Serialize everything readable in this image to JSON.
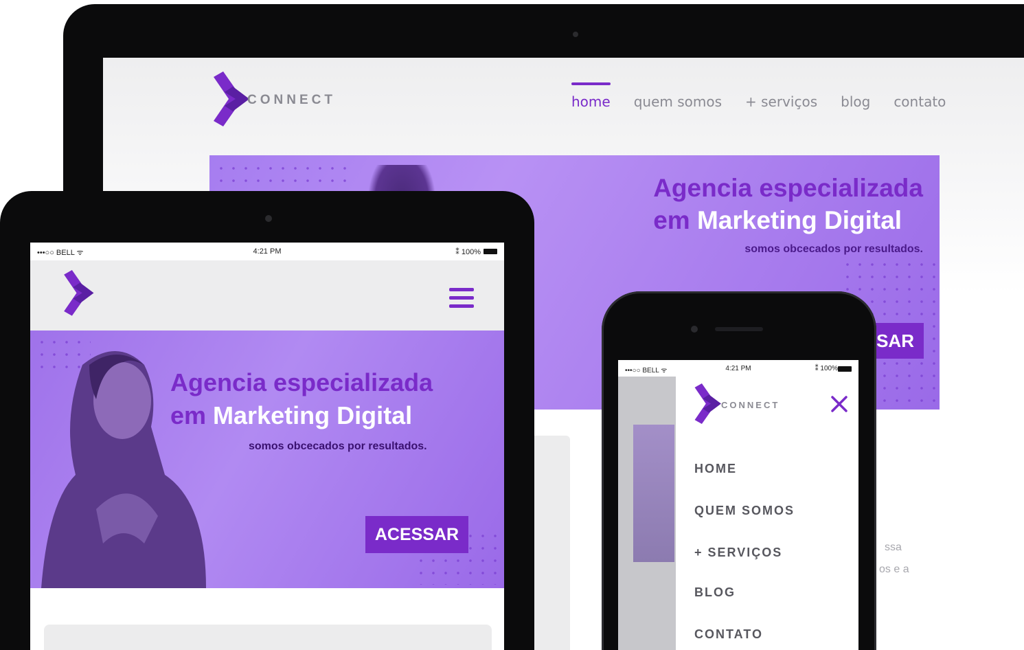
{
  "desktop": {
    "brand": "CONNECT",
    "nav": [
      {
        "label": "home",
        "active": true
      },
      {
        "label": "quem somos",
        "active": false
      },
      {
        "label": "+ serviços",
        "active": false
      },
      {
        "label": "blog",
        "active": false
      },
      {
        "label": "contato",
        "active": false
      }
    ],
    "hero": {
      "line1": "Agencia especializada",
      "line2a": "em",
      "line2b": "Marketing Digital",
      "subtitle": "somos obcecados por resultados.",
      "button_partial": "SAR"
    },
    "text_fragments": [
      "ssa",
      "os e a"
    ]
  },
  "tablet": {
    "status": {
      "carrier": "•••○○ BELL ᯤ",
      "time": "4:21 PM",
      "battery": "⁑ 100%"
    },
    "hero": {
      "line1": "Agencia especializada",
      "line2a": "em",
      "line2b": "Marketing Digital",
      "subtitle": "somos obcecados por resultados.",
      "button": "ACESSAR"
    }
  },
  "phone": {
    "status": {
      "carrier": "•••○○ BELL ᯤ",
      "time": "4:21 PM",
      "battery": "⁑ 100%"
    },
    "brand": "CONNECT",
    "menu": [
      "HOME",
      "QUEM SOMOS",
      "+ SERVIÇOS",
      "BLOG",
      "CONTATO"
    ]
  },
  "colors": {
    "accent": "#7a2bc9",
    "hero": "#a67df0",
    "nav_text": "#8a8a92"
  },
  "icons": {
    "logo": "connect-logo-icon",
    "menu": "hamburger-icon",
    "close": "close-icon"
  }
}
